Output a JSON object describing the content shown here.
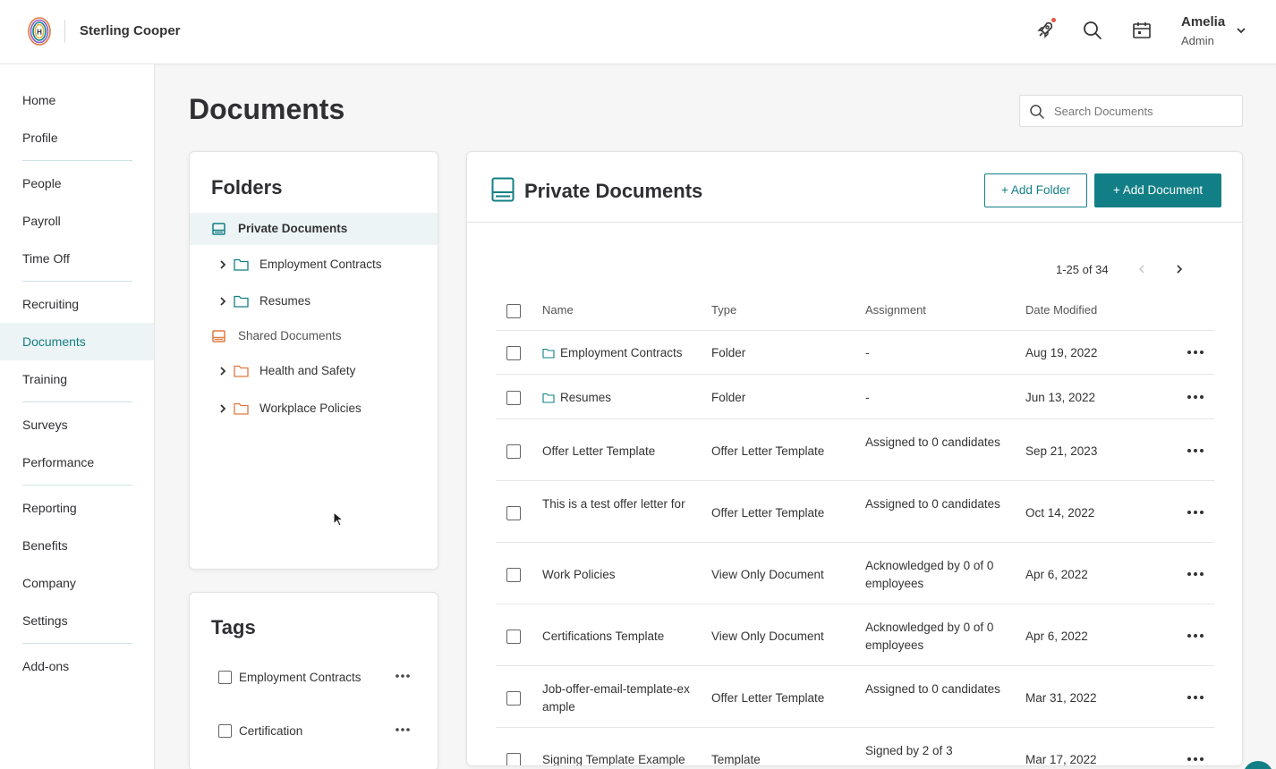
{
  "header": {
    "company": "Sterling Cooper",
    "user_name": "Amelia",
    "user_role": "Admin",
    "logo_letter": "H",
    "icons": [
      "rocket-icon",
      "search-icon",
      "calendar-icon",
      "chevron-down-icon"
    ]
  },
  "sidebar": {
    "items": [
      {
        "label": "Home"
      },
      {
        "label": "Profile"
      },
      {
        "label": "People"
      },
      {
        "label": "Payroll"
      },
      {
        "label": "Time Off"
      },
      {
        "label": "Recruiting"
      },
      {
        "label": "Documents",
        "active": true
      },
      {
        "label": "Training"
      },
      {
        "label": "Surveys"
      },
      {
        "label": "Performance"
      },
      {
        "label": "Reporting"
      },
      {
        "label": "Benefits"
      },
      {
        "label": "Company"
      },
      {
        "label": "Settings"
      },
      {
        "label": "Add-ons"
      }
    ]
  },
  "page": {
    "title": "Documents",
    "search_placeholder": "Search Documents"
  },
  "folders": {
    "title": "Folders",
    "items": [
      {
        "label": "Private Documents",
        "level": 0,
        "color": "#127f86"
      },
      {
        "label": "Employment Contracts",
        "level": 1,
        "color": "#127f86"
      },
      {
        "label": "Resumes",
        "level": 1,
        "color": "#127f86"
      },
      {
        "label": "Shared Documents",
        "level": 0,
        "color": "#e07a3f"
      },
      {
        "label": "Health and Safety",
        "level": 1,
        "color": "#e07a3f"
      },
      {
        "label": "Workplace Policies",
        "level": 1,
        "color": "#e07a3f"
      }
    ]
  },
  "tags": {
    "title": "Tags",
    "items": [
      {
        "label": "Employment Contracts"
      },
      {
        "label": "Certification"
      }
    ]
  },
  "docs": {
    "title": "Private Documents",
    "add_folder": "+ Add Folder",
    "add_document": "+ Add Document",
    "pager": "1-25 of 34",
    "columns": {
      "name": "Name",
      "type": "Type",
      "assignment": "Assignment",
      "date": "Date Modified"
    },
    "rows": [
      {
        "name": "Employment Contracts",
        "is_folder": true,
        "type": "Folder",
        "assignment": "-",
        "date": "Aug 19, 2022"
      },
      {
        "name": "Resumes",
        "is_folder": true,
        "type": "Folder",
        "assignment": "-",
        "date": "Jun 13, 2022"
      },
      {
        "name": "Offer Letter Template",
        "type": "Offer Letter Template",
        "assignment": "Assigned to 0 candidates",
        "date": "Sep 21, 2023"
      },
      {
        "name": "This is a test offer letter for",
        "type": "Offer Letter Template",
        "assignment": "Assigned to 0 candidates",
        "date": "Oct 14, 2022"
      },
      {
        "name": "Work Policies",
        "type": "View Only Document",
        "assignment": "Acknowledged by 0 of 0 employees",
        "date": "Apr 6, 2022"
      },
      {
        "name": "Certifications Template",
        "type": "View Only Document",
        "assignment": "Acknowledged by 0 of 0 employees",
        "date": "Apr 6, 2022"
      },
      {
        "name": "Job-offer-email-template-example",
        "type": "Offer Letter Template",
        "assignment": "Assigned to 0 candidates",
        "date": "Mar 31, 2022"
      },
      {
        "name": "Signing Template Example",
        "type": "Template",
        "assignment": "Signed by 2 of 3",
        "date": "Mar 17, 2022"
      }
    ]
  },
  "colors": {
    "accent": "#127f86",
    "shared": "#e07a3f",
    "active_bg": "#edf4f5"
  }
}
